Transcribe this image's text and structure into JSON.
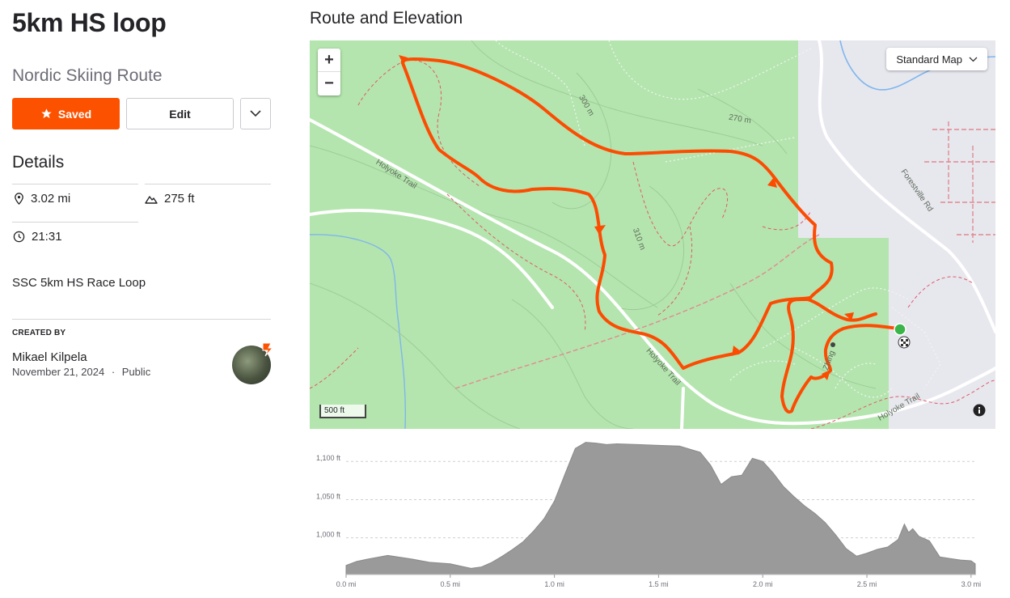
{
  "route": {
    "title": "5km HS loop",
    "sport": "Nordic Skiing Route",
    "saved_label": "Saved",
    "edit_label": "Edit"
  },
  "details": {
    "heading": "Details",
    "distance": "3.02 mi",
    "elevation_gain": "275 ft",
    "time": "21:31",
    "description": "SSC 5km HS Race Loop"
  },
  "creator": {
    "heading": "CREATED BY",
    "name": "Mikael Kilpela",
    "date": "November 21, 2024",
    "visibility": "Public",
    "separator": "·"
  },
  "map": {
    "heading": "Route and Elevation",
    "zoom_in": "+",
    "zoom_out": "−",
    "map_type": "Standard Map",
    "scale_label": "500 ft",
    "labels": {
      "holyoke_upper": "Holyoke Trail",
      "holyoke_mid": "Holyoke Trail",
      "holyoke_lower": "Holyoke Trail",
      "forestville": "Forestville Rd",
      "zhing": "Zhing",
      "c300a": "300 m",
      "c270": "270 m",
      "c310": "310 m"
    },
    "colors": {
      "route": "#fc4c02",
      "land": "#b4e5ae",
      "saved": "#fc5200"
    },
    "icons": [
      "plus-icon",
      "minus-icon",
      "chevron-down-icon",
      "info-icon",
      "start-marker-icon",
      "finish-flag-icon",
      "direction-arrow-icon"
    ]
  },
  "chart_data": {
    "type": "area",
    "ylabel_ticks": [
      "1,000 ft",
      "1,050 ft",
      "1,100 ft"
    ],
    "y_ticks": [
      1000,
      1050,
      1100
    ],
    "x_ticks": [
      "0.0 mi",
      "0.5 mi",
      "1.0 mi",
      "1.5 mi",
      "2.0 mi",
      "2.5 mi",
      "3.0 mi"
    ],
    "x_tick_values": [
      0,
      0.5,
      1.0,
      1.5,
      2.0,
      2.5,
      3.0
    ],
    "xlim": [
      0,
      3.02
    ],
    "ylim": [
      952,
      1132
    ],
    "grid": true,
    "x": [
      0,
      0.05,
      0.1,
      0.2,
      0.3,
      0.4,
      0.5,
      0.55,
      0.6,
      0.65,
      0.7,
      0.75,
      0.8,
      0.85,
      0.9,
      0.95,
      1.0,
      1.05,
      1.1,
      1.15,
      1.2,
      1.25,
      1.3,
      1.4,
      1.5,
      1.6,
      1.7,
      1.75,
      1.8,
      1.85,
      1.9,
      1.95,
      2.0,
      2.05,
      2.1,
      2.15,
      2.2,
      2.25,
      2.3,
      2.35,
      2.4,
      2.45,
      2.5,
      2.55,
      2.6,
      2.65,
      2.68,
      2.7,
      2.72,
      2.75,
      2.8,
      2.85,
      2.9,
      2.95,
      3.0,
      3.02
    ],
    "y": [
      964,
      969,
      972,
      977,
      973,
      968,
      966,
      963,
      960,
      962,
      968,
      976,
      985,
      995,
      1009,
      1025,
      1048,
      1083,
      1117,
      1125,
      1124,
      1122,
      1123,
      1122,
      1121,
      1120,
      1112,
      1095,
      1070,
      1080,
      1082,
      1104,
      1100,
      1085,
      1067,
      1054,
      1042,
      1032,
      1020,
      1004,
      986,
      976,
      980,
      985,
      988,
      998,
      1018,
      1007,
      1012,
      1002,
      996,
      975,
      973,
      971,
      970,
      966
    ]
  }
}
